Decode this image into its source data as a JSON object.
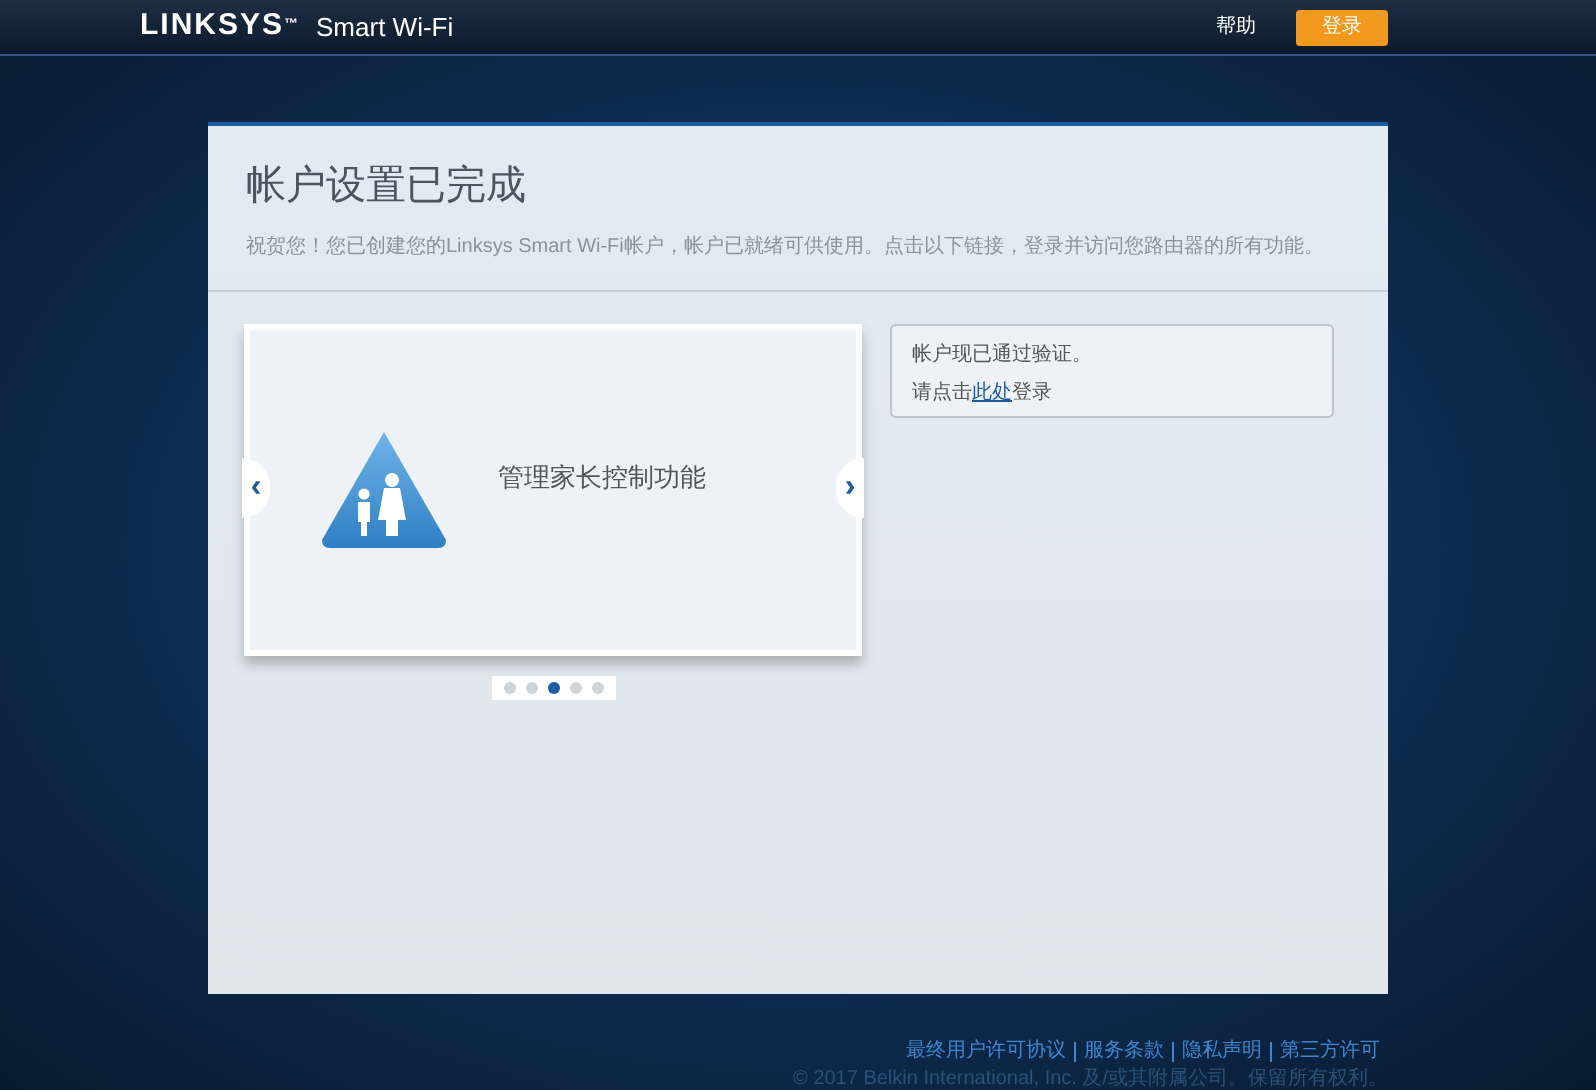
{
  "header": {
    "logo": "LINKSYS",
    "logo_mark": "™",
    "product": "Smart Wi-Fi",
    "help": "帮助",
    "login_button": "登录"
  },
  "card": {
    "title": "帐户设置已完成",
    "subtitle": "祝贺您！您已创建您的Linksys Smart Wi-Fi帐户，帐户已就绪可供使用。点击以下链接，登录并访问您路由器的所有功能。"
  },
  "carousel": {
    "slide_title": "管理家长控制功能",
    "prev": "‹",
    "next": "›",
    "dots": [
      {
        "selected": false
      },
      {
        "selected": false
      },
      {
        "selected": true
      },
      {
        "selected": false
      },
      {
        "selected": false
      }
    ]
  },
  "info": {
    "verified": "帐户现已通过验证。",
    "prompt_before": "请点击",
    "link": "此处",
    "prompt_after": "登录"
  },
  "footer": {
    "links": [
      "最终用户许可协议",
      "服务条款",
      "隐私声明",
      "第三方许可"
    ],
    "copyright": "© 2017 Belkin International, Inc. 及/或其附属公司。保留所有权利。"
  }
}
